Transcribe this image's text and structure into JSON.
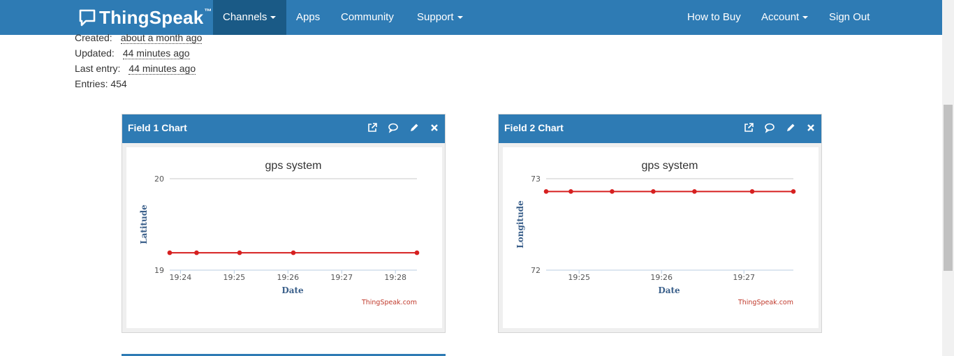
{
  "navbar": {
    "brand": "ThingSpeak",
    "brand_tm": "™",
    "items": [
      "Channels",
      "Apps",
      "Community",
      "Support"
    ],
    "right_items": [
      "How to Buy",
      "Account",
      "Sign Out"
    ]
  },
  "channel_info": {
    "created_label": "Created:",
    "created_value": "about a month ago",
    "updated_label": "Updated:",
    "updated_value": "44 minutes ago",
    "last_entry_label": "Last entry:",
    "last_entry_value": "44 minutes ago",
    "entries": "Entries: 454"
  },
  "panels": [
    {
      "title": "Field 1 Chart"
    },
    {
      "title": "Field 2 Chart"
    }
  ],
  "colors": {
    "nav": "#2e7bb4",
    "nav_active": "#1a5a86",
    "line": "#d62020"
  },
  "chart_data": [
    {
      "type": "line",
      "title": "gps system",
      "xlabel": "Date",
      "ylabel": "Latitude",
      "credit": "ThingSpeak.com",
      "ylim": [
        19,
        20
      ],
      "yticks": [
        "20",
        "19"
      ],
      "xticks": [
        "19:24",
        "19:25",
        "19:26",
        "19:27",
        "19:28"
      ],
      "xlim": [
        "19:23.8",
        "19:28.4"
      ],
      "series": [
        {
          "x": [
            "19:23.8",
            "19:24.3",
            "19:25.1",
            "19:26.1",
            "19:28.4"
          ],
          "y": [
            19.19,
            19.19,
            19.19,
            19.19,
            19.19
          ]
        }
      ]
    },
    {
      "type": "line",
      "title": "gps system",
      "xlabel": "Date",
      "ylabel": "Longitude",
      "credit": "ThingSpeak.com",
      "ylim": [
        72,
        73
      ],
      "yticks": [
        "73",
        "72"
      ],
      "xticks": [
        "19:25",
        "19:26",
        "19:27"
      ],
      "xlim": [
        "19:24.6",
        "19:27.6"
      ],
      "series": [
        {
          "x": [
            "19:24.6",
            "19:24.9",
            "19:25.4",
            "19:25.9",
            "19:26.4",
            "19:27.1",
            "19:27.6"
          ],
          "y": [
            72.86,
            72.86,
            72.86,
            72.86,
            72.86,
            72.86,
            72.86
          ]
        }
      ]
    }
  ]
}
